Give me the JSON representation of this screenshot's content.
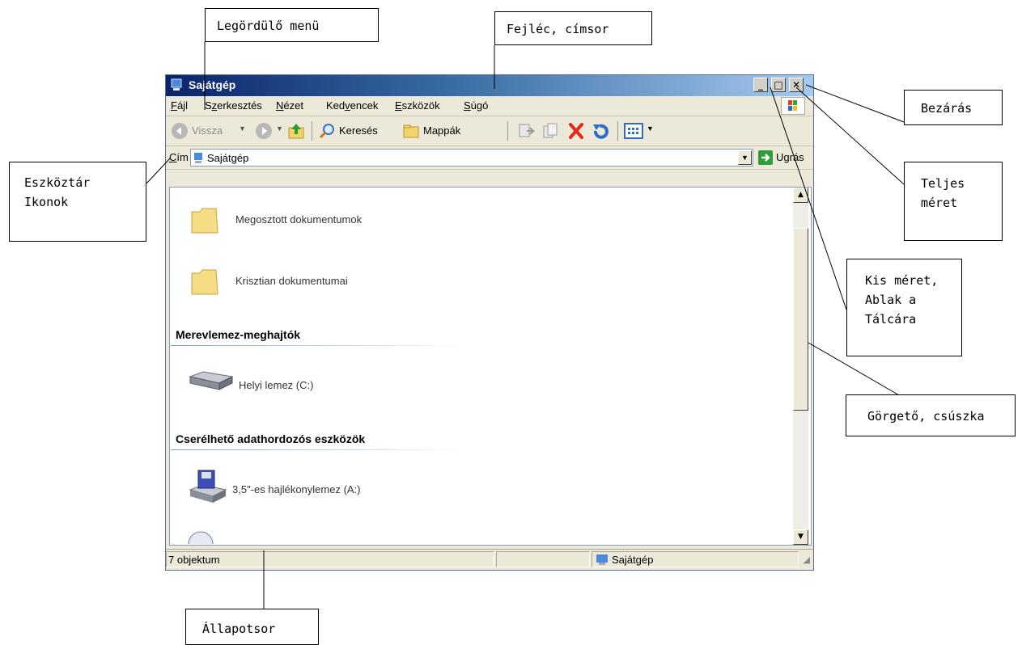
{
  "window": {
    "title": "Sajátgép",
    "title_bar_color": "#0a246a",
    "buttons": {
      "minimize": "_",
      "maximize": "□",
      "close": "✕"
    }
  },
  "menu": {
    "items": [
      {
        "prefix": "",
        "accel": "F",
        "rest": "ájl"
      },
      {
        "prefix": "S",
        "accel": "z",
        "rest": "erkesztés"
      },
      {
        "prefix": "",
        "accel": "N",
        "rest": "ézet"
      },
      {
        "prefix": "Ked",
        "accel": "v",
        "rest": "encek"
      },
      {
        "prefix": "",
        "accel": "E",
        "rest": "szközök"
      },
      {
        "prefix": "",
        "accel": "S",
        "rest": "úgó"
      }
    ]
  },
  "toolbar": {
    "back_label": "Vissza",
    "search_label": "Keresés",
    "folders_label": "Mappák",
    "icons": [
      "back-icon",
      "forward-icon",
      "up-folder-icon",
      "search-icon",
      "folders-icon",
      "move-to-icon",
      "copy-to-icon",
      "delete-icon",
      "undo-icon",
      "views-icon"
    ]
  },
  "address": {
    "label_accel": "C",
    "label_rest": "ím",
    "value": "Sajátgép",
    "go_label": "Ugrás"
  },
  "content": {
    "folders": [
      "Megosztott dokumentumok",
      "Krisztian dokumentumai"
    ],
    "sections": [
      {
        "title": "Merevlemez-meghajtók",
        "items": [
          "Helyi lemez (C:)"
        ]
      },
      {
        "title": "Cserélhető adathordozós eszközök",
        "items": [
          "3,5\"-es hajlékonylemez (A:)"
        ]
      }
    ]
  },
  "status": {
    "objects": "7 objektum",
    "location": "Sajátgép"
  },
  "callouts": {
    "dropdown_menu": "Legördülő menü",
    "header": "Fejléc, címsor",
    "close": "Bezárás",
    "toolbar": [
      "Eszköztár",
      "Ikonok"
    ],
    "maximize": [
      "Teljes",
      "méret"
    ],
    "minimize": [
      "Kis méret,",
      "Ablak a",
      "Tálcára"
    ],
    "scroll": "Görgető, csúszka",
    "statusbar": "Állapotsor"
  }
}
